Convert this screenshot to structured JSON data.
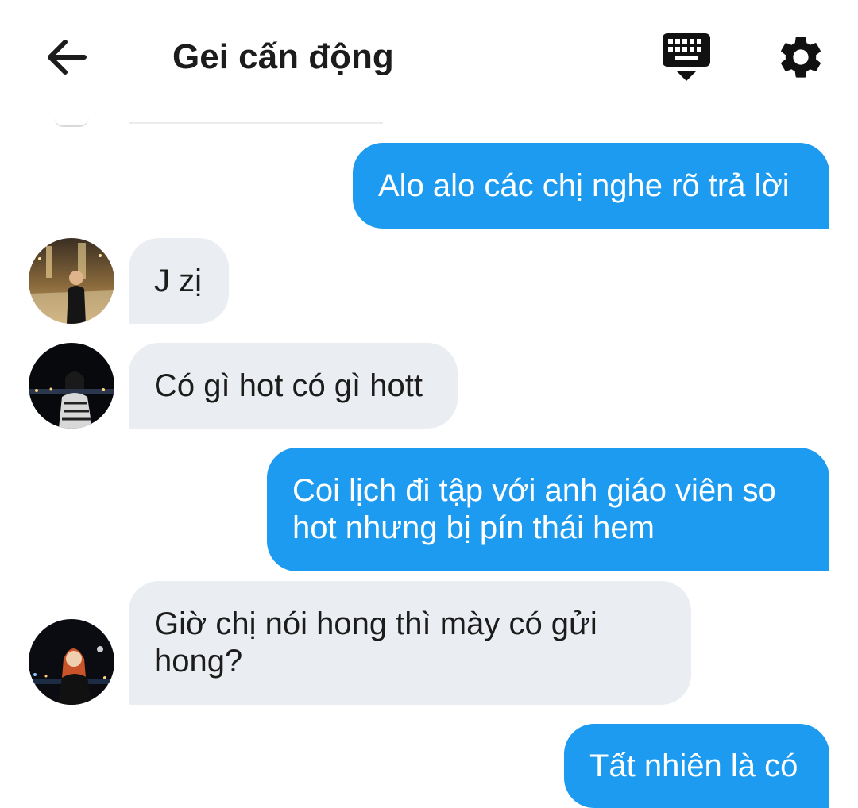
{
  "header": {
    "title": "Gei cấn động",
    "back_icon": "arrow-left-icon",
    "keyboard_icon": "keyboard-hide-icon",
    "settings_icon": "gear-icon"
  },
  "colors": {
    "outgoing_bubble": "#1d9bf0",
    "incoming_bubble": "#eaedf1",
    "text_dark": "#1c1c1c"
  },
  "messages": [
    {
      "direction": "outgoing",
      "text": "Alo alo các chị nghe rõ trả lời"
    },
    {
      "direction": "incoming",
      "text": "J zị"
    },
    {
      "direction": "incoming",
      "text": "Có gì hot có gì hott"
    },
    {
      "direction": "outgoing",
      "text": "Coi lịch đi tập với anh giáo viên so hot nhưng bị pín thái hem"
    },
    {
      "direction": "incoming",
      "text": "Giờ chị nói hong thì mày có gửi hong?"
    },
    {
      "direction": "outgoing",
      "text": "Tất nhiên là có"
    }
  ]
}
